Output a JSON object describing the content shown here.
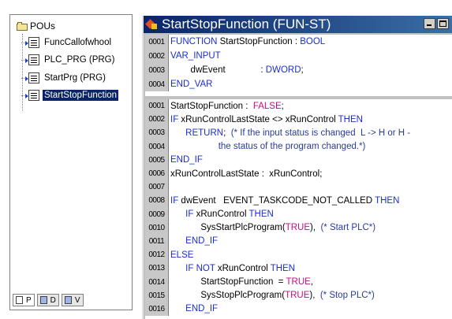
{
  "tree": {
    "root_label": "POUs",
    "items": [
      {
        "label": "FuncCallofwhool"
      },
      {
        "label": "PLC_PRG (PRG)"
      },
      {
        "label": "StartPrg (PRG)"
      },
      {
        "label": "StartStopFunction"
      }
    ],
    "tabs": [
      {
        "label": "P"
      },
      {
        "label": "D"
      },
      {
        "label": "V"
      }
    ]
  },
  "editor": {
    "title": "StartStopFunction (FUN-ST)",
    "declaration_lines": [
      {
        "num": "0001",
        "segments": [
          {
            "t": "FUNCTION ",
            "c": "kw"
          },
          {
            "t": "StartStopFunction : ",
            "c": ""
          },
          {
            "t": "BOOL",
            "c": "kw"
          }
        ]
      },
      {
        "num": "0002",
        "segments": [
          {
            "t": "VAR_INPUT",
            "c": "kw"
          }
        ]
      },
      {
        "num": "0003",
        "segments": [
          {
            "t": "        dwEvent              : ",
            "c": ""
          },
          {
            "t": "DWORD",
            "c": "kw"
          },
          {
            "t": ";",
            "c": ""
          }
        ]
      },
      {
        "num": "0004",
        "segments": [
          {
            "t": "END_VAR",
            "c": "kw"
          }
        ]
      }
    ],
    "body_lines": [
      {
        "num": "0001",
        "segments": [
          {
            "t": "StartStopFunction :  ",
            "c": ""
          },
          {
            "t": "FALSE",
            "c": "fl"
          },
          {
            "t": ";",
            "c": ""
          }
        ]
      },
      {
        "num": "0002",
        "segments": [
          {
            "t": "IF ",
            "c": "kw"
          },
          {
            "t": "xRunControlLastState <> xRunControl ",
            "c": ""
          },
          {
            "t": "THEN",
            "c": "kw"
          }
        ]
      },
      {
        "num": "0003",
        "segments": [
          {
            "t": "      RETURN",
            "c": "kw"
          },
          {
            "t": ";  ",
            "c": ""
          },
          {
            "t": "(* If the input status is changed  L -> H or H -",
            "c": "cm"
          }
        ]
      },
      {
        "num": "0004",
        "segments": [
          {
            "t": "                   the status of the program changed.*)",
            "c": "cm"
          }
        ]
      },
      {
        "num": "0005",
        "segments": [
          {
            "t": "END_IF",
            "c": "kw"
          }
        ]
      },
      {
        "num": "0006",
        "segments": [
          {
            "t": "xRunControlLastState :  xRunControl;",
            "c": ""
          }
        ]
      },
      {
        "num": "0007",
        "segments": []
      },
      {
        "num": "0008",
        "segments": [
          {
            "t": "IF ",
            "c": "kw"
          },
          {
            "t": "dwEvent   EVENT_TASKCODE_NOT_CALLED ",
            "c": ""
          },
          {
            "t": "THEN",
            "c": "kw"
          }
        ]
      },
      {
        "num": "0009",
        "segments": [
          {
            "t": "      IF ",
            "c": "kw"
          },
          {
            "t": "xRunControl ",
            "c": ""
          },
          {
            "t": "THEN",
            "c": "kw"
          }
        ]
      },
      {
        "num": "0010",
        "segments": [
          {
            "t": "            SysStartPlcProgram(",
            "c": ""
          },
          {
            "t": "TRUE",
            "c": "fl"
          },
          {
            "t": "),  ",
            "c": ""
          },
          {
            "t": "(* Start PLC*)",
            "c": "cm"
          }
        ]
      },
      {
        "num": "0011",
        "segments": [
          {
            "t": "      END_IF",
            "c": "kw"
          }
        ]
      },
      {
        "num": "0012",
        "segments": [
          {
            "t": "ELSE",
            "c": "kw"
          }
        ]
      },
      {
        "num": "0013",
        "segments": [
          {
            "t": "      IF NOT ",
            "c": "kw"
          },
          {
            "t": "xRunControl ",
            "c": ""
          },
          {
            "t": "THEN",
            "c": "kw"
          }
        ]
      },
      {
        "num": "0014",
        "segments": [
          {
            "t": "            StartStopFunction  = ",
            "c": ""
          },
          {
            "t": "TRUE",
            "c": "fl"
          },
          {
            "t": ",",
            "c": ""
          }
        ]
      },
      {
        "num": "0015",
        "segments": [
          {
            "t": "            SysStopPlcProgram(",
            "c": ""
          },
          {
            "t": "TRUE",
            "c": "fl"
          },
          {
            "t": "),  ",
            "c": ""
          },
          {
            "t": "(* Stop PLC*)",
            "c": "cm"
          }
        ]
      },
      {
        "num": "0016",
        "segments": [
          {
            "t": "      END_IF",
            "c": "kw"
          }
        ]
      }
    ]
  },
  "colors": {
    "keyword": "#1a2fd0",
    "comment": "#2a3a9a",
    "literal": "#c01080",
    "titlebar": "#0a246a",
    "selection": "#0a246a"
  }
}
